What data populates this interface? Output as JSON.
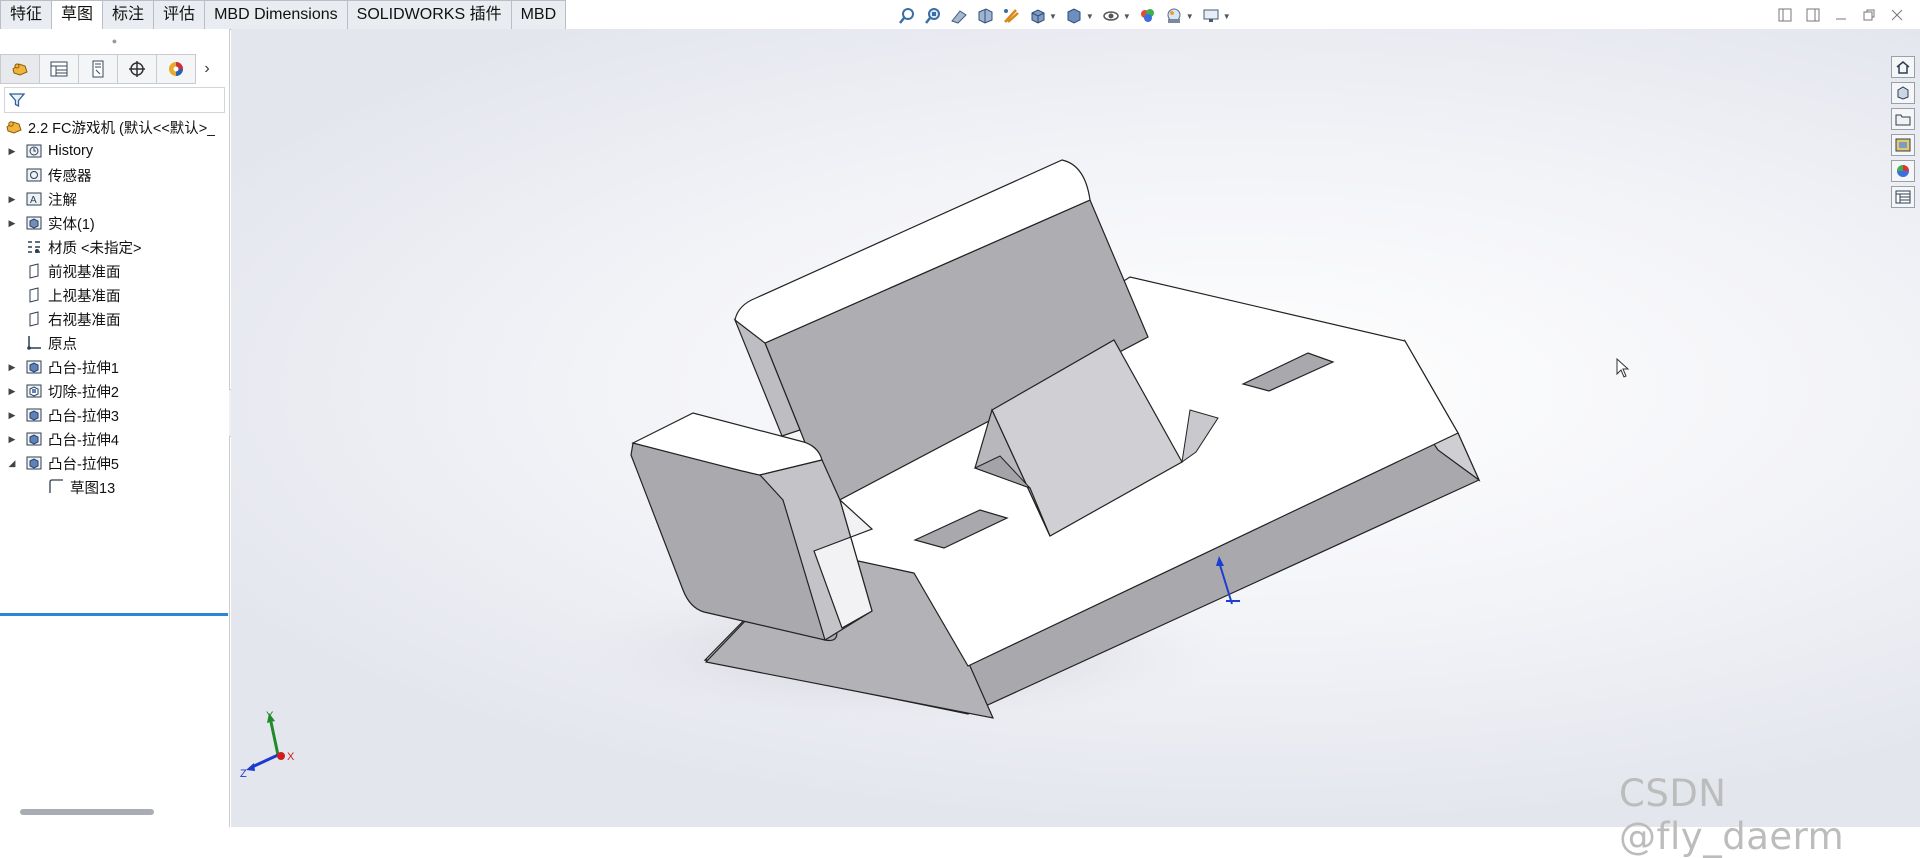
{
  "tabs": [
    {
      "label": "特征",
      "active": false
    },
    {
      "label": "草图",
      "active": true
    },
    {
      "label": "标注",
      "active": false
    },
    {
      "label": "评估",
      "active": false
    },
    {
      "label": "MBD Dimensions",
      "active": false
    },
    {
      "label": "SOLIDWORKS 插件",
      "active": false
    },
    {
      "label": "MBD",
      "active": false
    }
  ],
  "hud_icons": [
    "zoom-to-fit-icon",
    "zoom-area-icon",
    "previous-view-icon",
    "section-view-icon",
    "dynamic-annotation-icon",
    "view-orientation-icon",
    "display-style-icon",
    "hide-show-icon",
    "edit-appearance-icon",
    "apply-scene-icon",
    "view-settings-icon"
  ],
  "panel_tabs": [
    "featuremanager-icon",
    "propertymanager-icon",
    "configurationmanager-icon",
    "dimxpert-icon",
    "display-manager-icon"
  ],
  "tree": {
    "root": "2.2 FC游戏机  (默认<<默认>_",
    "items": [
      {
        "label": "History",
        "icon": "history-icon",
        "expand": "collapsed"
      },
      {
        "label": "传感器",
        "icon": "sensor-icon",
        "expand": "none"
      },
      {
        "label": "注解",
        "icon": "annotation-icon",
        "expand": "collapsed"
      },
      {
        "label": "实体(1)",
        "icon": "solid-bodies-icon",
        "expand": "collapsed"
      },
      {
        "label": "材质 <未指定>",
        "icon": "material-icon",
        "expand": "none"
      },
      {
        "label": "前视基准面",
        "icon": "plane-icon",
        "expand": "none"
      },
      {
        "label": "上视基准面",
        "icon": "plane-icon",
        "expand": "none"
      },
      {
        "label": "右视基准面",
        "icon": "plane-icon",
        "expand": "none"
      },
      {
        "label": "原点",
        "icon": "origin-icon",
        "expand": "none"
      },
      {
        "label": "凸台-拉伸1",
        "icon": "boss-extrude-icon",
        "expand": "collapsed"
      },
      {
        "label": "切除-拉伸2",
        "icon": "cut-extrude-icon",
        "expand": "collapsed"
      },
      {
        "label": "凸台-拉伸3",
        "icon": "boss-extrude-icon",
        "expand": "collapsed"
      },
      {
        "label": "凸台-拉伸4",
        "icon": "boss-extrude-icon",
        "expand": "collapsed"
      },
      {
        "label": "凸台-拉伸5",
        "icon": "boss-extrude-icon",
        "expand": "expanded"
      },
      {
        "label": "草图13",
        "icon": "sketch-icon",
        "expand": "child"
      }
    ]
  },
  "triad": {
    "x": "X",
    "y": "Y",
    "z": "Z"
  },
  "task_pane": [
    "home-icon",
    "parts-library-icon",
    "file-explorer-icon",
    "view-palette-icon",
    "appearances-icon",
    "custom-properties-icon"
  ],
  "watermark": "CSDN @fly_daerm",
  "colors": {
    "selection_blue": "#2e84d6",
    "model_face_light": "#ffffff",
    "model_face_dark": "#a9a8ad",
    "model_face_mid": "#c8c7cb"
  }
}
